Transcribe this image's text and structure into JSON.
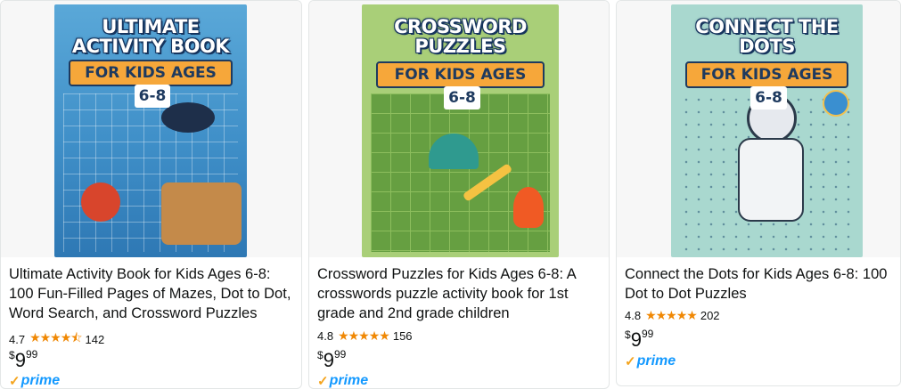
{
  "products": [
    {
      "cover_title": "ULTIMATE ACTIVITY BOOK",
      "cover_band": "FOR KIDS AGES",
      "cover_age": "6-8",
      "title": "Ultimate Activity Book for Kids Ages 6-8: 100 Fun-Filled Pages of Mazes, Dot to Dot, Word Search, and Crossword Puzzles",
      "rating": "4.7",
      "stars": "★★★★⯪",
      "review_count": "142",
      "price_currency": "$",
      "price_whole": "9",
      "price_fraction": "99",
      "prime_label": "prime"
    },
    {
      "cover_title": "CROSSWORD PUZZLES",
      "cover_band": "FOR KIDS AGES",
      "cover_age": "6-8",
      "title": "Crossword Puzzles for Kids Ages 6-8: A crosswords puzzle activity book for 1st grade and 2nd grade children",
      "rating": "4.8",
      "stars": "★★★★★",
      "review_count": "156",
      "price_currency": "$",
      "price_whole": "9",
      "price_fraction": "99",
      "prime_label": "prime"
    },
    {
      "cover_title": "CONNECT THE DOTS",
      "cover_band": "FOR KIDS AGES",
      "cover_age": "6-8",
      "title": "Connect the Dots for Kids Ages 6-8: 100 Dot to Dot Puzzles",
      "rating": "4.8",
      "stars": "★★★★★",
      "review_count": "202",
      "price_currency": "$",
      "price_whole": "9",
      "price_fraction": "99",
      "prime_label": "prime"
    }
  ],
  "colors": {
    "star": "#f08804",
    "prime": "#1399ff",
    "prime_check": "#f4a41e"
  }
}
